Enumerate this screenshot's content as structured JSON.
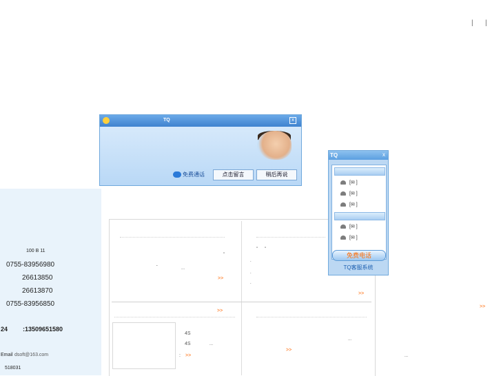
{
  "topbar": {
    "sep1": "|",
    "sep2": "|"
  },
  "contact": {
    "address": "100 B 11",
    "phone1": "0755-83956980",
    "phone2": "26613850",
    "phone3": "26613870",
    "phone4": "0755-83956850",
    "hotline_prefix": "24",
    "hotline": ":13509651580",
    "email_label": "Email",
    "email": "dsoft@163.com",
    "postcode": "518031"
  },
  "content": {
    "more_labels": [
      ">>",
      ">>",
      ">>",
      ">>",
      ">>",
      ">>"
    ],
    "ellipses": [
      "...",
      "...",
      "...",
      "..."
    ],
    "snippets": {
      "s4a": "4S",
      "s4b": "4S",
      "colon": ":",
      "quote": "\"",
      "quote2": "\"",
      "dot": "."
    }
  },
  "tq_popup": {
    "title": "TQ",
    "close": "x",
    "free_call": "免费通话",
    "leave_message": "点击留言",
    "later": "稍后再说"
  },
  "tq_widget": {
    "title": "TQ",
    "close": "x",
    "rows": [
      "[✉ ]",
      "[✉ ]",
      "[✉ ]",
      "[✉ ]",
      "[✉ ]"
    ],
    "free_call": "免费电话",
    "footer": "TQ客服系统"
  }
}
